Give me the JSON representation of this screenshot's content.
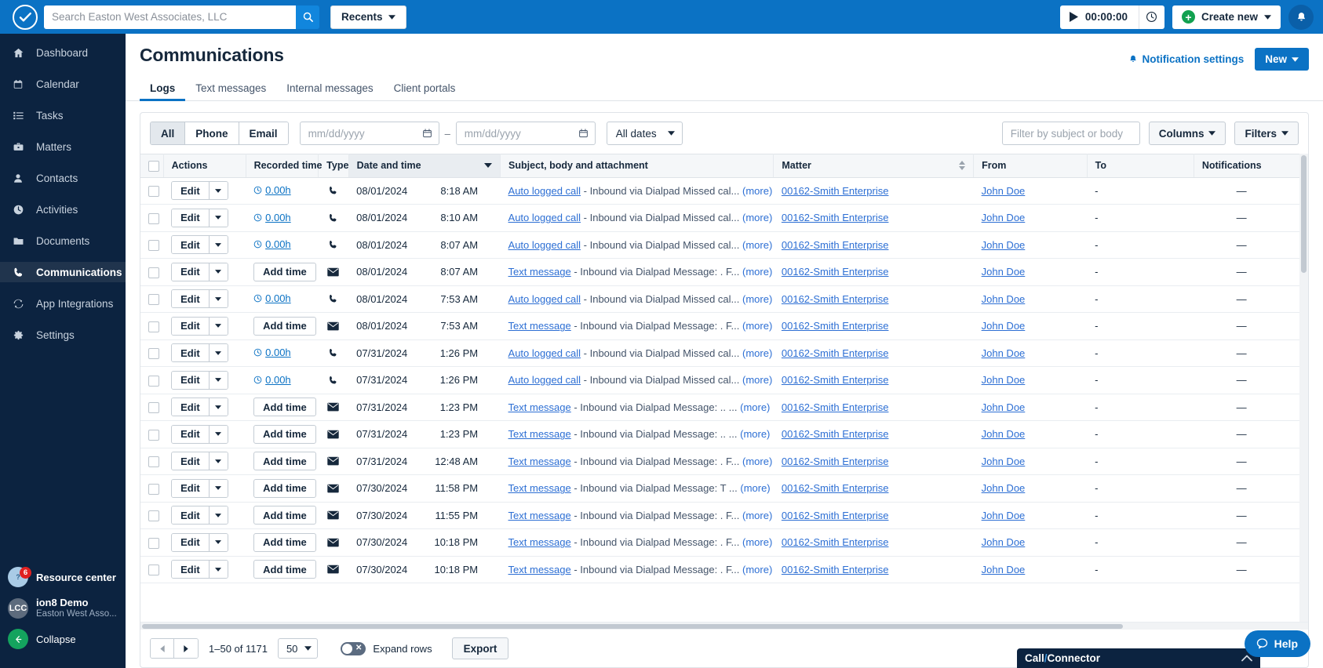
{
  "topbar": {
    "logo_icon": "checkmark-shield-logo",
    "search_placeholder": "Search Easton West Associates, LLC",
    "search_value": "",
    "search_icon": "search-icon",
    "recents_label": "Recents",
    "timer_value": "00:00:00",
    "timer_play_icon": "play-icon",
    "timer_clock_icon": "clock-icon",
    "create_new_label": "Create new",
    "plus_icon": "plus-icon",
    "bell_icon": "bell-icon",
    "accent": "#0b72c4"
  },
  "sidebar": {
    "items": [
      {
        "label": "Dashboard",
        "icon": "home-icon",
        "active": false
      },
      {
        "label": "Calendar",
        "icon": "calendar-icon",
        "active": false
      },
      {
        "label": "Tasks",
        "icon": "list-icon",
        "active": false
      },
      {
        "label": "Matters",
        "icon": "briefcase-icon",
        "active": false
      },
      {
        "label": "Contacts",
        "icon": "person-icon",
        "active": false
      },
      {
        "label": "Activities",
        "icon": "clock-icon",
        "active": false
      },
      {
        "label": "Documents",
        "icon": "folder-icon",
        "active": false
      },
      {
        "label": "Communications",
        "icon": "phone-icon",
        "active": true
      },
      {
        "label": "App Integrations",
        "icon": "sync-icon",
        "active": false
      },
      {
        "label": "Settings",
        "icon": "gear-icon",
        "active": false
      }
    ],
    "resource_center": {
      "label": "Resource center",
      "badge": "6",
      "icon": "question-circle-icon"
    },
    "account": {
      "initials": "LCC",
      "name": "ion8 Demo",
      "org": "Easton West Asso..."
    },
    "collapse": {
      "label": "Collapse",
      "icon": "arrow-left-icon"
    }
  },
  "page": {
    "title": "Communications",
    "notification_settings_label": "Notification settings",
    "notification_bell_icon": "bell-icon",
    "new_button_label": "New",
    "tabs": [
      {
        "label": "Logs",
        "active": true
      },
      {
        "label": "Text messages",
        "active": false
      },
      {
        "label": "Internal messages",
        "active": false
      },
      {
        "label": "Client portals",
        "active": false
      }
    ]
  },
  "filters": {
    "segments": [
      {
        "label": "All",
        "selected": true
      },
      {
        "label": "Phone",
        "selected": false
      },
      {
        "label": "Email",
        "selected": false
      }
    ],
    "date_from_placeholder": "mm/dd/yyyy",
    "date_from_value": "",
    "date_to_placeholder": "mm/dd/yyyy",
    "date_to_value": "",
    "date_separator": "–",
    "calendar_icon": "calendar-icon",
    "all_dates_label": "All dates",
    "subject_filter_placeholder": "Filter by subject or body",
    "subject_filter_value": "",
    "columns_label": "Columns",
    "filters_label": "Filters"
  },
  "table": {
    "columns": [
      {
        "key": "checkbox",
        "label": ""
      },
      {
        "key": "actions",
        "label": "Actions"
      },
      {
        "key": "recorded_time",
        "label": "Recorded time"
      },
      {
        "key": "type",
        "label": "Type"
      },
      {
        "key": "date_and_time",
        "label": "Date and time",
        "sorted": true,
        "sort_icon": "caret-down-icon"
      },
      {
        "key": "subject",
        "label": "Subject, body and attachment"
      },
      {
        "key": "matter",
        "label": "Matter",
        "sort_icon": "sort-updown-icon"
      },
      {
        "key": "from",
        "label": "From"
      },
      {
        "key": "to",
        "label": "To"
      },
      {
        "key": "notifications",
        "label": "Notifications"
      }
    ],
    "edit_label": "Edit",
    "add_time_label": "Add time",
    "more_label": "(more)",
    "rows": [
      {
        "recorded_time": "0.00h",
        "has_time": true,
        "type": "phone-icon",
        "date": "08/01/2024",
        "time": "8:18 AM",
        "subject_link": "Auto logged call",
        "subject_body": "- Inbound via Dialpad Missed cal...",
        "matter": "00162-Smith Enterprise",
        "from": "John Doe",
        "to": "-",
        "notifications": "—"
      },
      {
        "recorded_time": "0.00h",
        "has_time": true,
        "type": "phone-icon",
        "date": "08/01/2024",
        "time": "8:10 AM",
        "subject_link": "Auto logged call",
        "subject_body": "- Inbound via Dialpad Missed cal...",
        "matter": "00162-Smith Enterprise",
        "from": "John Doe",
        "to": "-",
        "notifications": "—"
      },
      {
        "recorded_time": "0.00h",
        "has_time": true,
        "type": "phone-icon",
        "date": "08/01/2024",
        "time": "8:07 AM",
        "subject_link": "Auto logged call",
        "subject_body": "- Inbound via Dialpad Missed cal...",
        "matter": "00162-Smith Enterprise",
        "from": "John Doe",
        "to": "-",
        "notifications": "—"
      },
      {
        "recorded_time": "Add time",
        "has_time": false,
        "type": "envelope-icon",
        "date": "08/01/2024",
        "time": "8:07 AM",
        "subject_link": "Text message",
        "subject_body": "- Inbound via Dialpad Message: . F...",
        "matter": "00162-Smith Enterprise",
        "from": "John Doe",
        "to": "-",
        "notifications": "—"
      },
      {
        "recorded_time": "0.00h",
        "has_time": true,
        "type": "phone-icon",
        "date": "08/01/2024",
        "time": "7:53 AM",
        "subject_link": "Auto logged call",
        "subject_body": "- Inbound via Dialpad Missed cal...",
        "matter": "00162-Smith Enterprise",
        "from": "John Doe",
        "to": "-",
        "notifications": "—"
      },
      {
        "recorded_time": "Add time",
        "has_time": false,
        "type": "envelope-icon",
        "date": "08/01/2024",
        "time": "7:53 AM",
        "subject_link": "Text message",
        "subject_body": "- Inbound via Dialpad Message: . F...",
        "matter": "00162-Smith Enterprise",
        "from": "John Doe",
        "to": "-",
        "notifications": "—"
      },
      {
        "recorded_time": "0.00h",
        "has_time": true,
        "type": "phone-icon",
        "date": "07/31/2024",
        "time": "1:26 PM",
        "subject_link": "Auto logged call",
        "subject_body": "- Inbound via Dialpad Missed cal...",
        "matter": "00162-Smith Enterprise",
        "from": "John Doe",
        "to": "-",
        "notifications": "—"
      },
      {
        "recorded_time": "0.00h",
        "has_time": true,
        "type": "phone-icon",
        "date": "07/31/2024",
        "time": "1:26 PM",
        "subject_link": "Auto logged call",
        "subject_body": "- Inbound via Dialpad Missed cal...",
        "matter": "00162-Smith Enterprise",
        "from": "John Doe",
        "to": "-",
        "notifications": "—"
      },
      {
        "recorded_time": "Add time",
        "has_time": false,
        "type": "envelope-icon",
        "date": "07/31/2024",
        "time": "1:23 PM",
        "subject_link": "Text message",
        "subject_body": "- Inbound via Dialpad Message: .. ...",
        "matter": "00162-Smith Enterprise",
        "from": "John Doe",
        "to": "-",
        "notifications": "—"
      },
      {
        "recorded_time": "Add time",
        "has_time": false,
        "type": "envelope-icon",
        "date": "07/31/2024",
        "time": "1:23 PM",
        "subject_link": "Text message",
        "subject_body": "- Inbound via Dialpad Message: .. ...",
        "matter": "00162-Smith Enterprise",
        "from": "John Doe",
        "to": "-",
        "notifications": "—"
      },
      {
        "recorded_time": "Add time",
        "has_time": false,
        "type": "envelope-icon",
        "date": "07/31/2024",
        "time": "12:48 AM",
        "subject_link": "Text message",
        "subject_body": "- Inbound via Dialpad Message: . F...",
        "matter": "00162-Smith Enterprise",
        "from": "John Doe",
        "to": "-",
        "notifications": "—"
      },
      {
        "recorded_time": "Add time",
        "has_time": false,
        "type": "envelope-icon",
        "date": "07/30/2024",
        "time": "11:58 PM",
        "subject_link": "Text message",
        "subject_body": "- Inbound via Dialpad Message: T ...",
        "matter": "00162-Smith Enterprise",
        "from": "John Doe",
        "to": "-",
        "notifications": "—"
      },
      {
        "recorded_time": "Add time",
        "has_time": false,
        "type": "envelope-icon",
        "date": "07/30/2024",
        "time": "11:55 PM",
        "subject_link": "Text message",
        "subject_body": "- Inbound via Dialpad Message: . F...",
        "matter": "00162-Smith Enterprise",
        "from": "John Doe",
        "to": "-",
        "notifications": "—"
      },
      {
        "recorded_time": "Add time",
        "has_time": false,
        "type": "envelope-icon",
        "date": "07/30/2024",
        "time": "10:18 PM",
        "subject_link": "Text message",
        "subject_body": "- Inbound via Dialpad Message: . F...",
        "matter": "00162-Smith Enterprise",
        "from": "John Doe",
        "to": "-",
        "notifications": "—"
      },
      {
        "recorded_time": "Add time",
        "has_time": false,
        "type": "envelope-icon",
        "date": "07/30/2024",
        "time": "10:18 PM",
        "subject_link": "Text message",
        "subject_body": "- Inbound via Dialpad Message: . F...",
        "matter": "00162-Smith Enterprise",
        "from": "John Doe",
        "to": "-",
        "notifications": "—"
      }
    ]
  },
  "footer": {
    "prev_icon": "caret-left-icon",
    "next_icon": "caret-right-icon",
    "range_text": "1–50 of 1171",
    "page_size": "50",
    "expand_rows_label": "Expand rows",
    "expand_rows_on": false,
    "export_label": "Export"
  },
  "overlays": {
    "help_label": "Help",
    "help_icon": "chat-bubble-icon",
    "connector_prefix": "Call",
    "connector_slash": "/",
    "connector_suffix": "Connector",
    "connector_chevron": "chevron-up-icon"
  }
}
